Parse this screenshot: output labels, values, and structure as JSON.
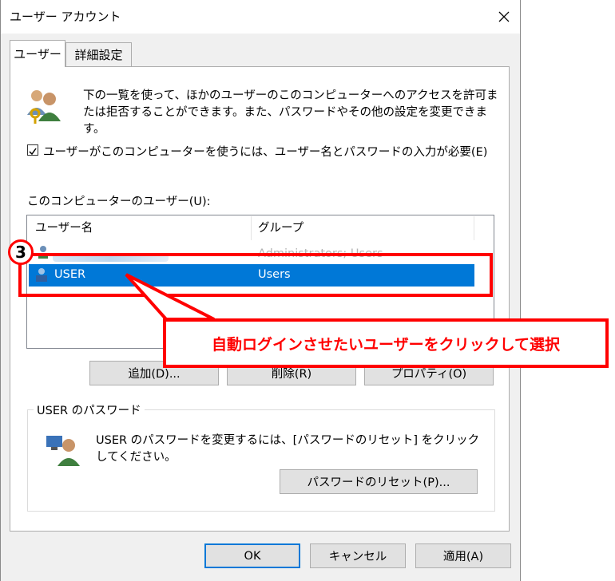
{
  "window": {
    "title": "ユーザー アカウント"
  },
  "tabs": [
    {
      "label": "ユーザー",
      "active": true
    },
    {
      "label": "詳細設定",
      "active": false
    }
  ],
  "description": "下の一覧を使って、ほかのユーザーのこのコンピューターへのアクセスを許可または拒否することができます。また、パスワードやその他の設定を変更できます。",
  "require_login": {
    "checked": true,
    "label": "ユーザーがこのコンピューターを使うには、ユーザー名とパスワードの入力が必要(E)"
  },
  "users_list": {
    "label": "このコンピューターのユーザー(U):",
    "columns": [
      "ユーザー名",
      "グループ"
    ],
    "rows": [
      {
        "name": "",
        "group": "Administrators; Users",
        "selected": false
      },
      {
        "name": "USER",
        "group": "Users",
        "selected": true
      }
    ]
  },
  "list_buttons": {
    "add": "追加(D)...",
    "remove": "削除(R)",
    "properties": "プロパティ(O)"
  },
  "password_group": {
    "title": "USER のパスワード",
    "description": "USER のパスワードを変更するには、[パスワードのリセット] をクリックしてください。",
    "reset_button": "パスワードのリセット(P)..."
  },
  "dialog_buttons": {
    "ok": "OK",
    "cancel": "キャンセル",
    "apply": "適用(A)"
  },
  "annotation": {
    "step_number": "3",
    "callout_text": "自動ログインさせたいユーザーをクリックして選択",
    "color": "#ff0000"
  },
  "colors": {
    "selection": "#0078d7",
    "dialog_bg": "#f0f0f0"
  }
}
